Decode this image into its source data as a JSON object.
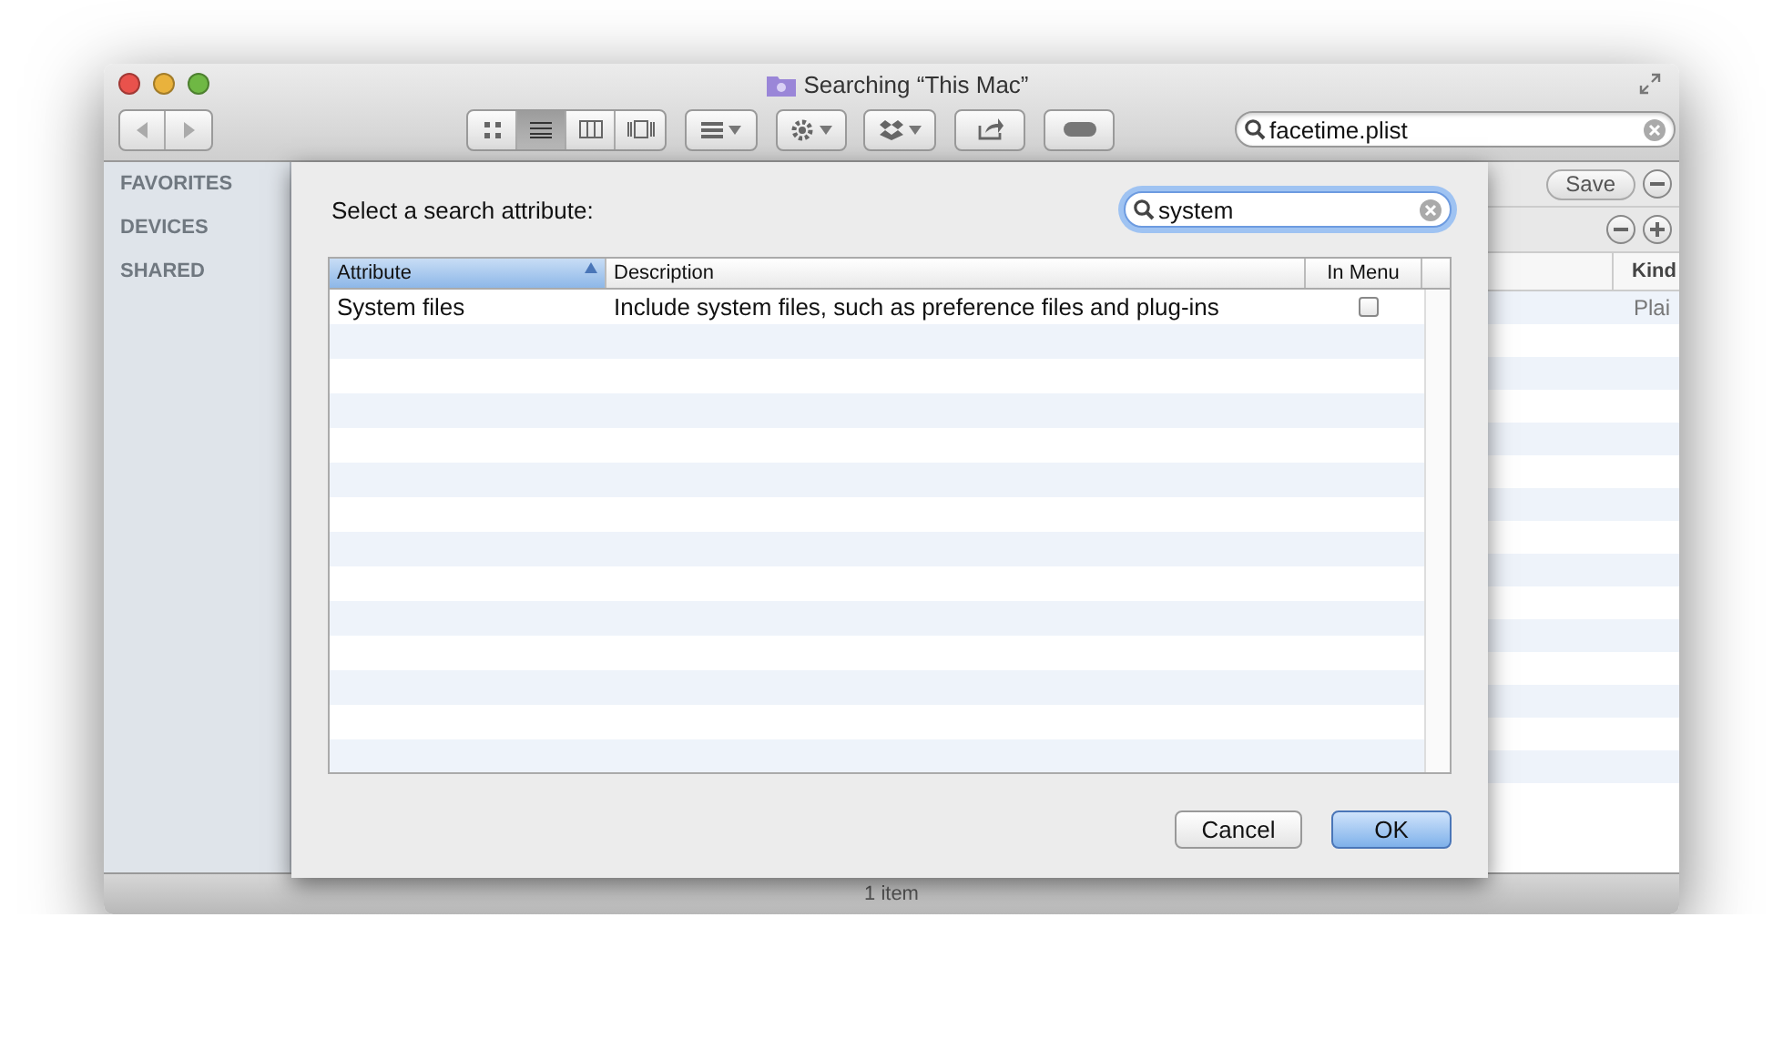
{
  "window": {
    "title": "Searching “This Mac”"
  },
  "toolbar": {
    "view_modes": [
      {
        "kind": "icons",
        "selected": false
      },
      {
        "kind": "list",
        "selected": true
      },
      {
        "kind": "columns",
        "selected": false
      },
      {
        "kind": "coverflow",
        "selected": false
      }
    ],
    "search": {
      "value": "facetime.plist"
    }
  },
  "sidebar": {
    "sections": [
      "FAVORITES",
      "DEVICES",
      "SHARED"
    ]
  },
  "results": {
    "save_button": "Save",
    "columns": [
      "Kind"
    ],
    "rows": [
      {
        "kind": "Plai"
      }
    ]
  },
  "status_bar": "1 item",
  "dialog": {
    "prompt": "Select a search attribute:",
    "search": {
      "value": "system"
    },
    "table": {
      "columns": [
        {
          "label": "Attribute",
          "selected": true
        },
        {
          "label": "Description",
          "selected": false
        },
        {
          "label": "In Menu",
          "selected": false
        }
      ],
      "rows": [
        {
          "attribute": "System files",
          "description": "Include system files, such as preference files and plug-ins",
          "in_menu": false
        }
      ]
    },
    "buttons": [
      {
        "label": "Cancel",
        "default": false
      },
      {
        "label": "OK",
        "default": true
      }
    ]
  }
}
